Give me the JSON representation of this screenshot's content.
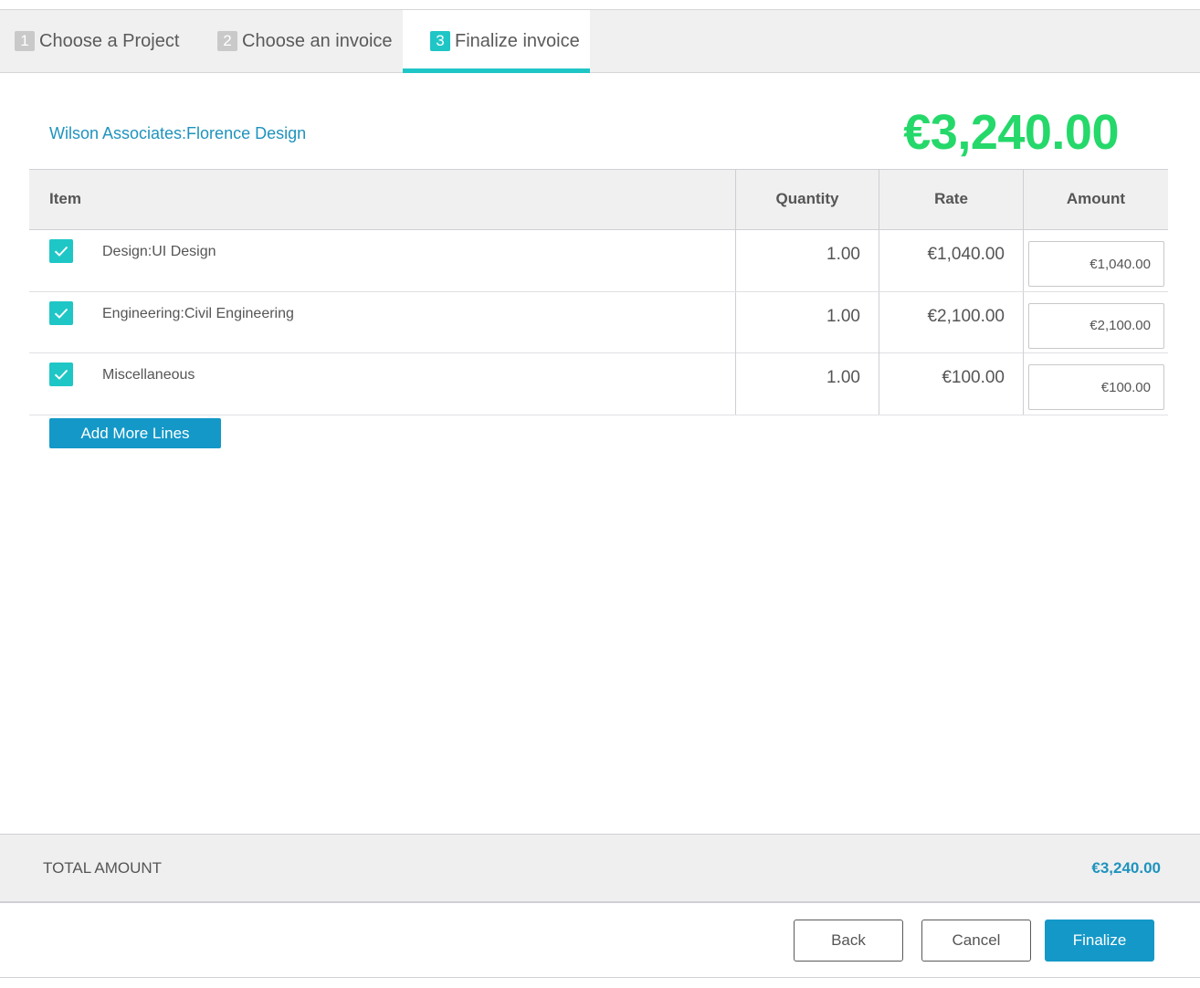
{
  "tabs": [
    {
      "num": "1",
      "label": "Choose a Project",
      "active": false
    },
    {
      "num": "2",
      "label": "Choose an invoice",
      "active": false
    },
    {
      "num": "3",
      "label": "Finalize invoice",
      "active": true
    }
  ],
  "header": {
    "customer": "Wilson Associates:Florence Design",
    "total": "€3,240.00"
  },
  "table": {
    "columns": [
      "Item",
      "Quantity",
      "Rate",
      "Amount"
    ],
    "rows": [
      {
        "checked": true,
        "item": "Design:UI Design",
        "quantity": "1.00",
        "rate": "€1,040.00",
        "amount": "€1,040.00"
      },
      {
        "checked": true,
        "item": "Engineering:Civil Engineering",
        "quantity": "1.00",
        "rate": "€2,100.00",
        "amount": "€2,100.00"
      },
      {
        "checked": true,
        "item": "Miscellaneous",
        "quantity": "1.00",
        "rate": "€100.00",
        "amount": "€100.00"
      }
    ]
  },
  "add_more_lines_label": "Add More Lines",
  "summary": {
    "label": "TOTAL AMOUNT",
    "value": "€3,240.00"
  },
  "footer": {
    "back_label": "Back",
    "cancel_label": "Cancel",
    "finalize_label": "Finalize"
  },
  "colors": {
    "accent_teal": "#1fc6c6",
    "primary_blue": "#1498c8",
    "total_green": "#25d86a",
    "link_blue": "#1f93bd"
  }
}
